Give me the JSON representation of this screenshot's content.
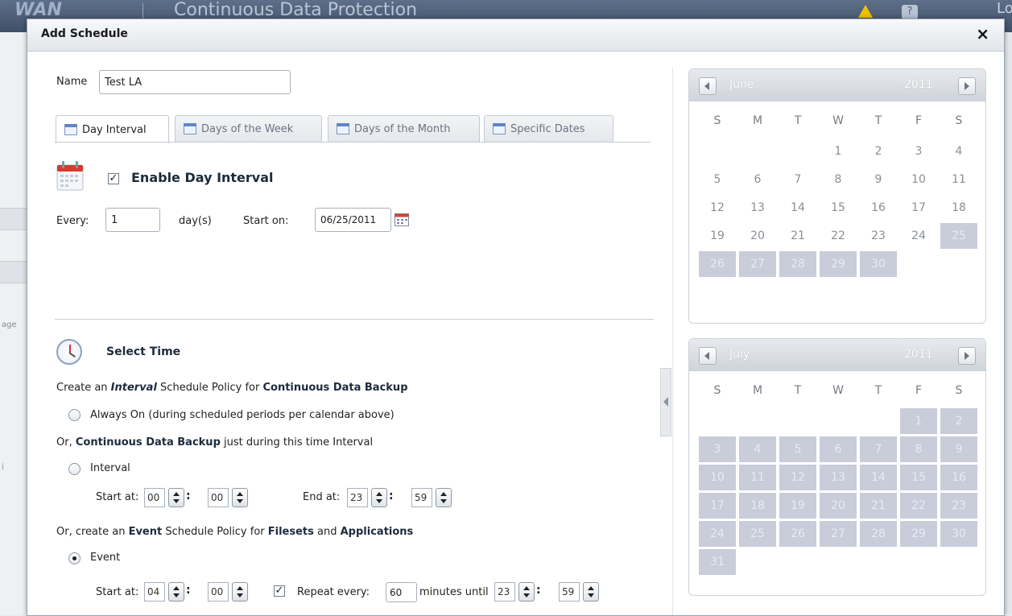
{
  "background": {
    "app_logo": "WAN",
    "app_title": "Continuous Data Protection",
    "right_text": "Log",
    "left_snippets": [
      "age",
      "i"
    ]
  },
  "dialog": {
    "title": "Add Schedule",
    "close_label": "×"
  },
  "form": {
    "name_label": "Name",
    "name_value": "Test LA"
  },
  "tabs": [
    {
      "label": "Day Interval",
      "active": true
    },
    {
      "label": "Days of the Week",
      "active": false
    },
    {
      "label": "Days of the Month",
      "active": false
    },
    {
      "label": "Specific Dates",
      "active": false
    }
  ],
  "day_interval": {
    "enable_label": "Enable Day Interval",
    "enabled": true,
    "every_label": "Every:",
    "every_value": "1",
    "unit_label": "day(s)",
    "start_label": "Start on:",
    "start_value": "06/25/2011"
  },
  "select_time": {
    "heading": "Select Time",
    "interval_policy": {
      "prefix": "Create an ",
      "em": "Interval",
      "middle": " Schedule Policy for ",
      "strong": "Continuous Data Backup"
    },
    "always_on_label": "Always On (during scheduled periods per calendar above)",
    "interval_intro": {
      "prefix": "Or, ",
      "strong": "Continuous Data Backup",
      "suffix": " just during this time Interval"
    },
    "interval_label": "Interval",
    "interval_start_label": "Start at:",
    "interval_start_h": "00",
    "interval_start_m": "00",
    "interval_end_label": "End at:",
    "interval_end_h": "23",
    "interval_end_m": "59",
    "event_intro": {
      "prefix": "Or, create an ",
      "strong1": "Event",
      "middle": " Schedule Policy for ",
      "strong2": "Filesets",
      "and": " and ",
      "strong3": "Applications"
    },
    "event_label": "Event",
    "event_start_label": "Start at:",
    "event_start_h": "04",
    "event_start_m": "00",
    "repeat_label": "Repeat every:",
    "repeat_value": "60",
    "repeat_suffix": "minutes until",
    "until_h": "23",
    "until_m": "59",
    "selected": "event"
  },
  "weekdays": [
    "S",
    "M",
    "T",
    "W",
    "T",
    "F",
    "S"
  ],
  "calendars": [
    {
      "month": "June",
      "year": "2011",
      "first_weekday": 3,
      "days": 30,
      "selected_from": 25
    },
    {
      "month": "July",
      "year": "2011",
      "first_weekday": 5,
      "days": 31,
      "selected_from": 1
    }
  ]
}
